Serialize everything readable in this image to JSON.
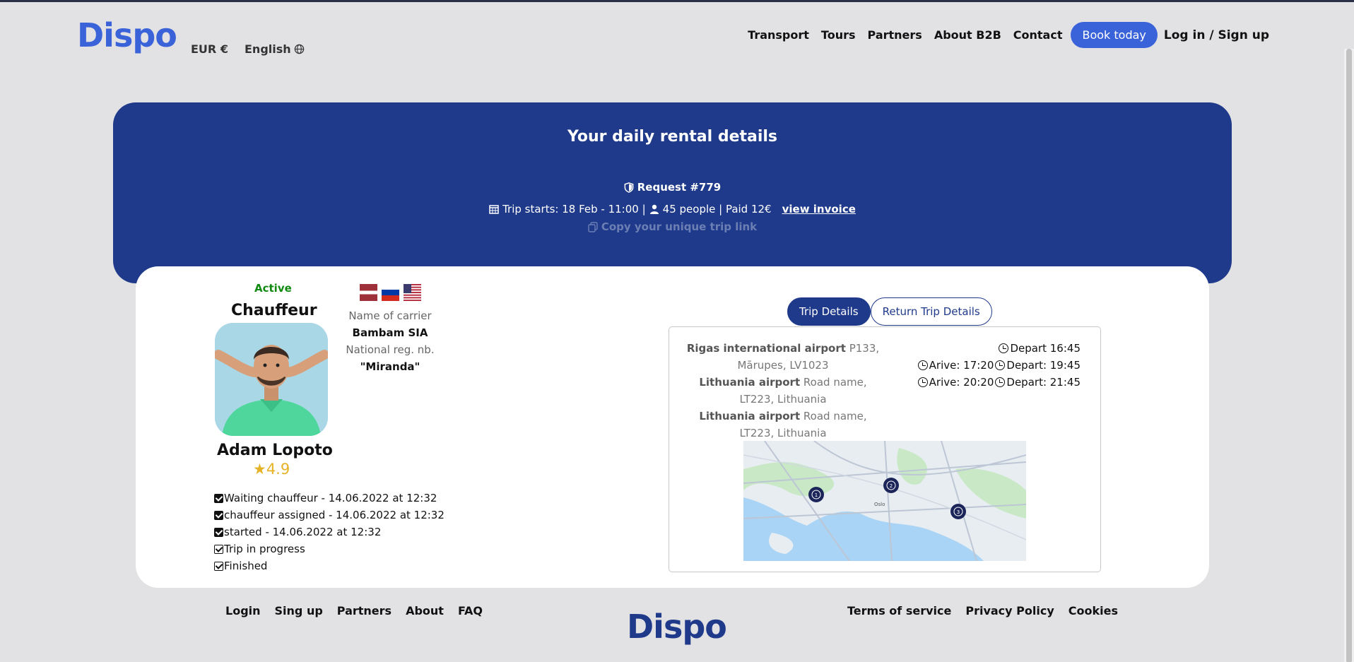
{
  "header": {
    "logo": "Dispo",
    "currency": "EUR €",
    "language": "English",
    "nav": [
      "Transport",
      "Tours",
      "Partners",
      "About B2B",
      "Contact"
    ],
    "book_label": "Book today",
    "login_label": "Log in / Sign up"
  },
  "hero": {
    "title": "Your daily rental details",
    "request": "Request #779",
    "trip_info": "Trip starts: 18 Feb - 11:00 |",
    "people_info": "45 people | Paid 12€",
    "invoice_link": "view invoice",
    "copy_link": "Copy your unique trip link"
  },
  "driver": {
    "status": "Active",
    "role": "Chauffeur",
    "name": "Adam Lopoto",
    "rating": "★4.9",
    "steps": [
      {
        "text": "Waiting chauffeur - 14.06.2022 at 12:32",
        "done": true
      },
      {
        "text": "chauffeur assigned - 14.06.2022 at 12:32",
        "done": true
      },
      {
        "text": "started - 14.06.2022 at 12:32",
        "done": true
      },
      {
        "text": "Trip in progress",
        "done": false
      },
      {
        "text": "Finished",
        "done": false
      }
    ]
  },
  "carrier": {
    "name_label": "Name of carrier",
    "name": "Bambam SIA",
    "reg_label": "National reg. nb.",
    "reg": "\"Miranda\""
  },
  "trip_tabs": {
    "active": "Trip Details",
    "inactive": "Return Trip Details"
  },
  "stops": [
    {
      "name": "Rigas international airport",
      "address": "P133, Mārupes, LV1023"
    },
    {
      "name": "Lithuania airport",
      "address": "Road name, LT223, Lithuania"
    },
    {
      "name": "Lithuania airport",
      "address": "Road name, LT223, Lithuania"
    }
  ],
  "times": [
    {
      "arrive": "",
      "depart": "Depart 16:45"
    },
    {
      "arrive": "Arive: 17:20",
      "depart": "Depart: 19:45"
    },
    {
      "arrive": "Arive: 20:20",
      "depart": "Depart: 21:45"
    }
  ],
  "map": {
    "label": "Oslo",
    "markers": [
      "1",
      "2",
      "3"
    ]
  },
  "footer": {
    "left_links": [
      "Login",
      "Sing up",
      "Partners",
      "About",
      "FAQ"
    ],
    "right_links": [
      "Terms of service",
      "Privacy Policy",
      "Cookies"
    ],
    "logo": "Dispo"
  },
  "colors": {
    "brand": "#3b63d9",
    "navy": "#1f3a8a",
    "active": "#118a11",
    "star": "#e6b326"
  }
}
